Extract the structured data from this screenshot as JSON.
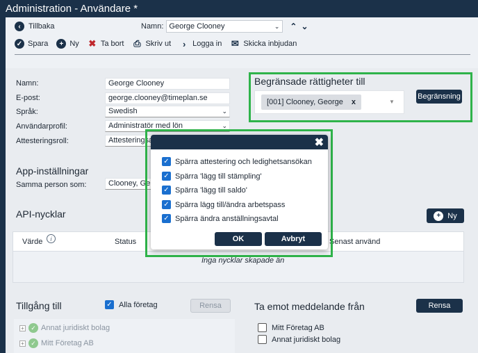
{
  "window": {
    "title": "Administration - Användare *"
  },
  "nav": {
    "back_label": "Tillbaka",
    "name_label": "Namn:",
    "name_value": "George Clooney"
  },
  "toolbar": {
    "save": "Spara",
    "new": "Ny",
    "delete": "Ta bort",
    "print": "Skriv ut",
    "login": "Logga in",
    "invite": "Skicka inbjudan"
  },
  "form": {
    "name_label": "Namn:",
    "name_value": "George Clooney",
    "email_label": "E-post:",
    "email_value": "george.clooney@timeplan.se",
    "language_label": "Språk:",
    "language_value": "Swedish",
    "profile_label": "Användarprofil:",
    "profile_value": "Administratör med lön",
    "attest_label": "Attesteringsroll:",
    "attest_value": "Attesteringsa"
  },
  "restrictions": {
    "title": "Begränsade rättigheter till",
    "chip_label": "[001] Clooney, George",
    "chip_remove": "x",
    "button": "Begränsning"
  },
  "app_settings": {
    "title": "App-inställningar",
    "same_person_label": "Samma person som:",
    "same_person_value": "Clooney, Ge"
  },
  "api_keys": {
    "title": "API-nycklar",
    "new_button": "Ny",
    "col_value": "Värde",
    "col_status": "Status",
    "col_last_used": "Senast använd",
    "empty": "Inga nycklar skapade än"
  },
  "access": {
    "title": "Tillgång till",
    "all_companies_label": "Alla företag",
    "clear_button": "Rensa",
    "tree": [
      "Annat juridiskt bolag",
      "Mitt Företag AB"
    ]
  },
  "messages": {
    "title": "Ta emot meddelande från",
    "clear_button": "Rensa",
    "options": [
      "Mitt Företag AB",
      "Annat juridiskt bolag"
    ]
  },
  "dialog": {
    "options": [
      "Spärra attestering och ledighetsansökan",
      "Spärra 'lägg till stämpling'",
      "Spärra 'lägg till saldo'",
      "Spärra lägg till/ändra arbetspass",
      "Spärra ändra anställningsavtal"
    ],
    "ok": "OK",
    "cancel": "Avbryt"
  },
  "colors": {
    "navy": "#1b3149",
    "highlight": "#2fb34a",
    "checkbox": "#1a6fcf"
  }
}
